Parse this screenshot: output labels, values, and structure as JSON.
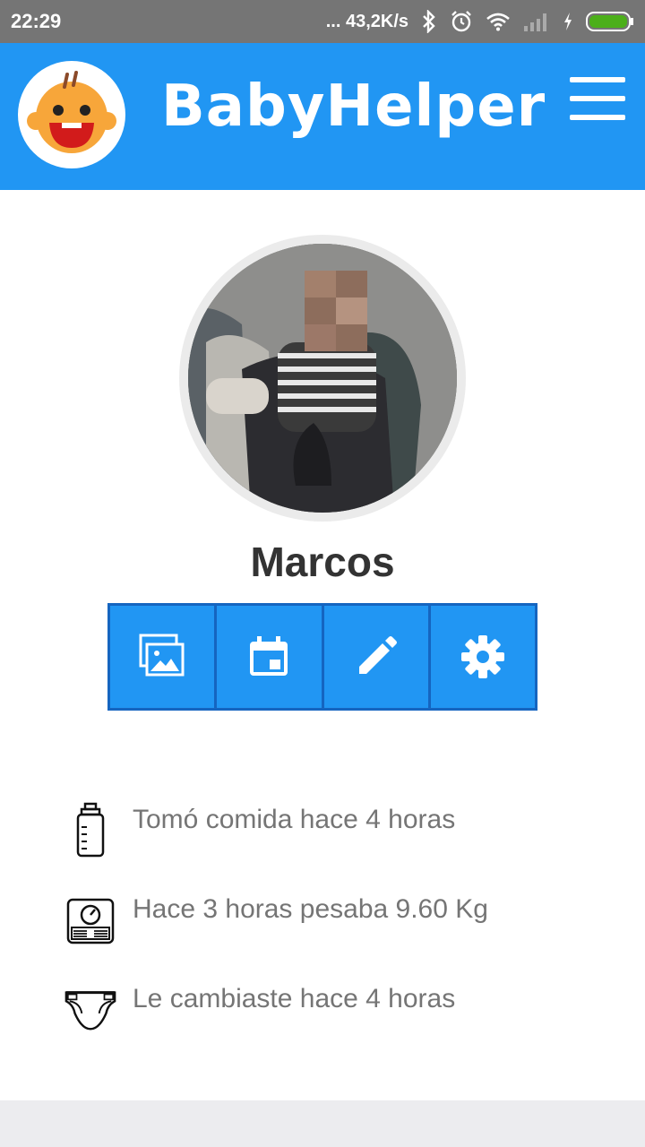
{
  "status_bar": {
    "time": "22:29",
    "network_speed": "... 43,2K/s"
  },
  "app": {
    "title": "BabyHelper",
    "colors": {
      "primary": "#2196F3",
      "primary_dark": "#1565C0",
      "text_secondary": "#757575"
    }
  },
  "profile": {
    "name": "Marcos"
  },
  "actions": [
    {
      "icon": "photos-icon"
    },
    {
      "icon": "calendar-icon"
    },
    {
      "icon": "edit-icon"
    },
    {
      "icon": "settings-icon"
    }
  ],
  "info": {
    "feeding": "Tomó comida hace 4 horas",
    "weight": "Hace 3 horas pesaba 9.60 Kg",
    "diaper": "Le cambiaste hace 4 horas"
  }
}
